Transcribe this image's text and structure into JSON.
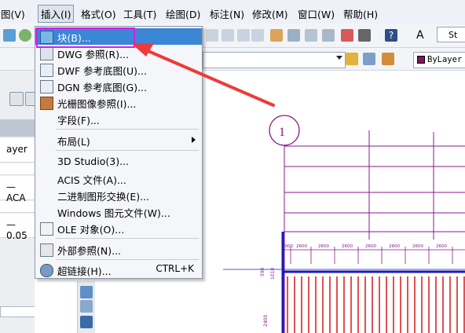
{
  "menubar": {
    "items": [
      "图(V)",
      "插入(I)",
      "格式(O)",
      "工具(T)",
      "绘图(D)",
      "标注(N)",
      "修改(M)",
      "窗口(W)",
      "帮助(H)"
    ]
  },
  "toolbar": {
    "style_value": "St",
    "bylayer_value": "ByLayer"
  },
  "properties": {
    "rows": [
      "ayer",
      "— ACA",
      "— 0.05"
    ]
  },
  "insert_menu": {
    "items": [
      {
        "label": "块(B)...",
        "shortcut": ""
      },
      {
        "label": "DWG 参照(R)...",
        "shortcut": ""
      },
      {
        "label": "DWF 参考底图(U)...",
        "shortcut": ""
      },
      {
        "label": "DGN 参考底图(G)...",
        "shortcut": ""
      },
      {
        "label": "光栅图像参照(I)...",
        "shortcut": ""
      },
      {
        "label": "字段(F)...",
        "shortcut": ""
      },
      {
        "label": "布局(L)",
        "shortcut": ""
      },
      {
        "label": "3D Studio(3)...",
        "shortcut": ""
      },
      {
        "label": "ACIS 文件(A)...",
        "shortcut": ""
      },
      {
        "label": "二进制图形交换(E)...",
        "shortcut": ""
      },
      {
        "label": "Windows 图元文件(W)...",
        "shortcut": ""
      },
      {
        "label": "OLE 对象(O)...",
        "shortcut": ""
      },
      {
        "label": "外部参照(N)...",
        "shortcut": ""
      },
      {
        "label": "超链接(H)...",
        "shortcut": "CTRL+K"
      }
    ]
  },
  "drawing": {
    "grid_bubble": "1",
    "dimensions": [
      "1000",
      "2600",
      "2600",
      "2600",
      "2600",
      "2600",
      "2600",
      "2600"
    ],
    "left_dims": [
      "590",
      "1010",
      "2400"
    ]
  },
  "colors": {
    "highlight_box": "#d21fe8",
    "arrow": "#ee3a3a",
    "selected_item": "#3c86d6",
    "drawing_lines": "#8a1a8a",
    "red_studs": "#d41818",
    "blue_beam": "#1a1ab8"
  }
}
